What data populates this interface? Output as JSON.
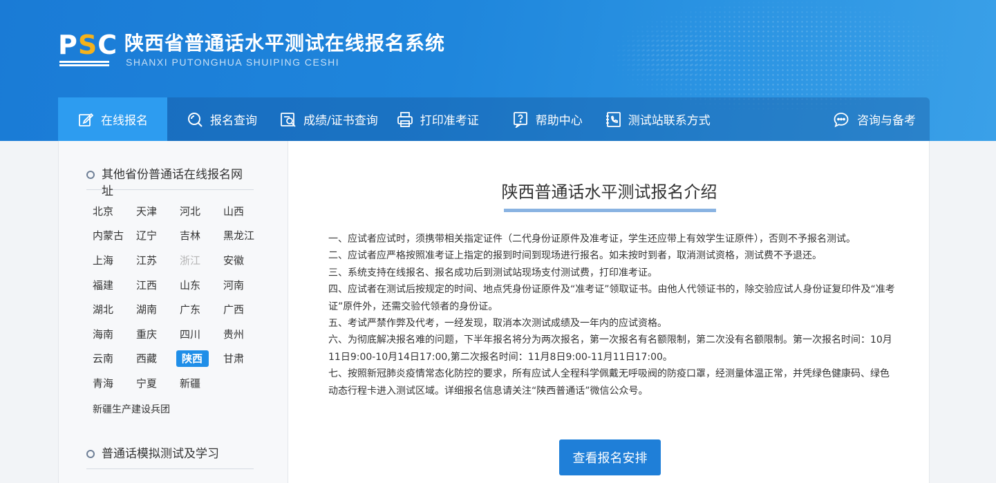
{
  "header": {
    "logo_text": "PSC",
    "title": "陕西省普通话水平测试在线报名系统",
    "subtitle": "SHANXI PUTONGHUA SHUIPING CESHI"
  },
  "nav": {
    "items": [
      {
        "label": "在线报名",
        "icon": "edit-icon"
      },
      {
        "label": "报名查询",
        "icon": "search-icon"
      },
      {
        "label": "成绩/证书查询",
        "icon": "certificate-search-icon"
      },
      {
        "label": "打印准考证",
        "icon": "printer-icon"
      },
      {
        "label": "帮助中心",
        "icon": "help-icon"
      },
      {
        "label": "测试站联系方式",
        "icon": "phone-contact-icon"
      },
      {
        "label": "咨询与备考",
        "icon": "chat-bubble-icon"
      }
    ],
    "active_index": 0,
    "accent": "#2d9cf0"
  },
  "sidebar": {
    "section1_title": "其他省份普通话在线报名网址",
    "provinces": [
      [
        "北京",
        "天津",
        "河北",
        "山西"
      ],
      [
        "内蒙古",
        "辽宁",
        "吉林",
        "黑龙江"
      ],
      [
        "上海",
        "江苏",
        "浙江",
        "安徽"
      ],
      [
        "福建",
        "江西",
        "山东",
        "河南"
      ],
      [
        "湖北",
        "湖南",
        "广东",
        "广西"
      ],
      [
        "海南",
        "重庆",
        "四川",
        "贵州"
      ],
      [
        "云南",
        "西藏",
        "陕西",
        "甘肃"
      ],
      [
        "青海",
        "宁夏",
        "新疆"
      ]
    ],
    "disabled": "浙江",
    "selected": "陕西",
    "extra_region": "新疆生产建设兵团",
    "section2_title": "普通话模拟测试及学习"
  },
  "main": {
    "title": "陕西普通话水平测试报名介绍",
    "rules": [
      "一、应试者应试时，须携带相关指定证件（二代身份证原件及准考证，学生还应带上有效学生证原件），否则不予报名测试。",
      "二、应试者应严格按照准考证上指定的报到时间到现场进行报名。如未按时到者，取消测试资格，测试费不予退还。",
      "三、系统支持在线报名、报名成功后到测试站现场支付测试费，打印准考证。",
      "四、应试者在测试后按规定的时间、地点凭身份证原件及“准考证”领取证书。由他人代领证书的，除交验应试人身份证复印件及“准考证”原件外，还需交验代领者的身份证。",
      "五、考试严禁作弊及代考，一经发现，取消本次测试成绩及一年内的应试资格。",
      "六、为彻底解决报名难的问题，下半年报名将分为两次报名，第一次报名有名额限制，第二次没有名额限制。第一次报名时间：10月11日9:00-10月14日17:00,第二次报名时间：11月8日9:00-11月11日17:00。",
      "七、按照新冠肺炎疫情常态化防控的要求，所有应试人全程科学佩戴无呼吸阀的防疫口罩，经测量体温正常，并凭绿色健康码、绿色动态行程卡进入测试区域。详细报名信息请关注“陕西普通话”微信公众号。"
    ],
    "cta_label": "查看报名安排"
  }
}
